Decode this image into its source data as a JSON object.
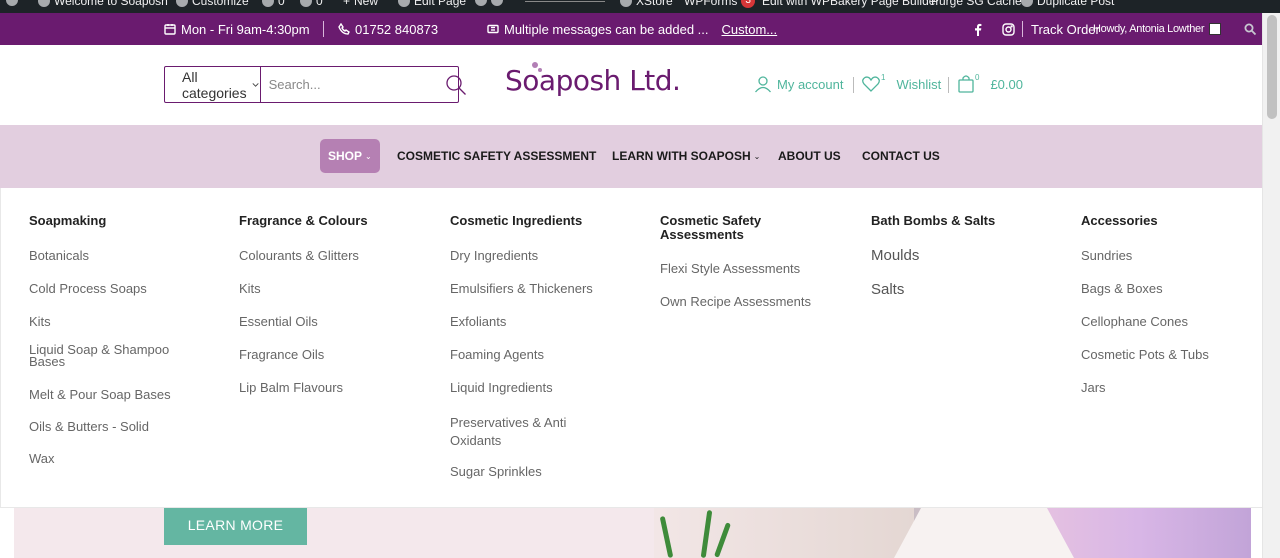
{
  "admin_bar": {
    "site_name": "Welcome to Soaposh",
    "customize": "Customize",
    "updates_count": "0",
    "comments_count": "0",
    "new_label": "New",
    "edit_page": "Edit Page",
    "xstore": "XStore",
    "wpforms": "WPForms",
    "wpforms_badge": "3",
    "wpbakery": "Edit with WPBakery Page Builder",
    "purge": "Purge SG Cache",
    "duplicate": "Duplicate Post"
  },
  "topbar": {
    "hours": "Mon - Fri 9am-4:30pm",
    "phone": "01752 840873",
    "message": "Multiple messages can be added ...",
    "custom_link": "Custom...",
    "track_order": "Track Order",
    "howdy": "Howdy, Antonia Lowther"
  },
  "header": {
    "category_select": "All categories",
    "search_placeholder": "Search...",
    "logo_text": "Soaposh Ltd.",
    "my_account": "My account",
    "wishlist": "Wishlist",
    "wishlist_count": "1",
    "cart_count": "0",
    "cart_total": "£0.00"
  },
  "nav": {
    "shop": "SHOP",
    "cosmetic_safety": "COSMETIC SAFETY ASSESSMENT",
    "learn": "LEARN WITH SOAPOSH",
    "about": "ABOUT US",
    "contact": "CONTACT US"
  },
  "mega_menu": {
    "columns": [
      {
        "heading": "Soapmaking",
        "items": [
          "Botanicals",
          "Cold Process Soaps",
          "Kits",
          "Liquid Soap & Shampoo Bases",
          "Melt & Pour Soap Bases",
          "Oils & Butters - Solid",
          "Wax"
        ]
      },
      {
        "heading": "Fragrance & Colours",
        "items": [
          "Colourants & Glitters",
          "Kits",
          "Essential Oils",
          "Fragrance Oils",
          "Lip Balm Flavours"
        ]
      },
      {
        "heading": "Cosmetic Ingredients",
        "items": [
          "Dry Ingredients",
          "Emulsifiers & Thickeners",
          "Exfoliants",
          "Foaming Agents",
          "Liquid Ingredients",
          "Preservatives & Anti Oxidants",
          "Sugar Sprinkles"
        ]
      },
      {
        "heading": "Cosmetic Safety Assessments",
        "items": [
          "Flexi Style Assessments",
          "Own Recipe Assessments"
        ]
      },
      {
        "heading": "Bath Bombs & Salts",
        "items": [
          "Moulds",
          "Salts"
        ]
      },
      {
        "heading": "Accessories",
        "items": [
          "Sundries",
          "Bags & Boxes",
          "Cellophane Cones",
          "Cosmetic Pots & Tubs",
          "Jars"
        ]
      }
    ]
  },
  "hero": {
    "learn_more": "LEARN MORE"
  },
  "colors": {
    "brand_purple": "#6a1b6f",
    "nav_bg": "#e2cedf",
    "shop_active": "#b580b3",
    "accent_teal": "#4fb59c"
  }
}
